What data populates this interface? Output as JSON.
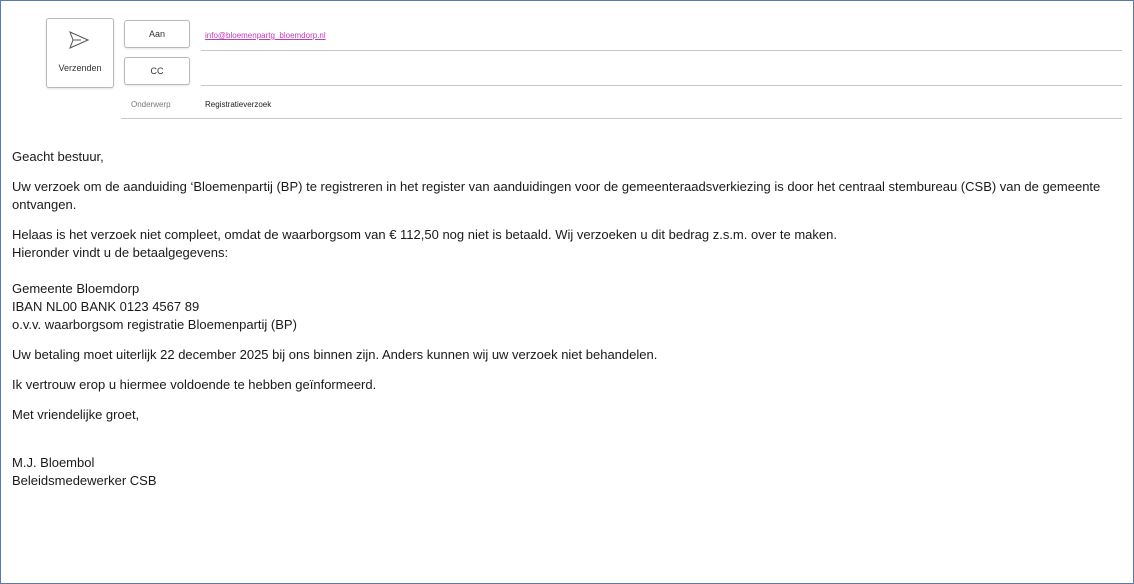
{
  "compose": {
    "send_label": "Verzenden",
    "to_label": "Aan",
    "to_value": "info@bloemenpartg_bloemdorp.nl",
    "cc_label": "CC",
    "cc_value": "",
    "subject_label": "Onderwerp",
    "subject_value": "Registratieverzoek"
  },
  "icons": {
    "send": "send-paper-plane-icon"
  },
  "colors": {
    "link": "#c03ab5",
    "frame_border": "#5a7aa8"
  },
  "body": {
    "greeting": "Geacht bestuur,",
    "p1": "Uw verzoek om de aanduiding ‘Bloemenpartij (BP) te registreren in het register van aanduidingen voor de gemeenteraadsverkiezing is door het centraal stembureau (CSB) van de gemeente ontvangen.",
    "p2_line1": "Helaas is het verzoek niet compleet, omdat de waarborgsom van € 112,50 nog niet is betaald. Wij verzoeken u dit bedrag z.s.m. over te maken.",
    "p2_line2": "Hieronder vindt u de betaalgegevens:",
    "pay_name": "Gemeente Bloemdorp",
    "pay_iban": "IBAN NL00 BANK 0123 4567 89",
    "pay_ref": "o.v.v. waarborgsom registratie Bloemenpartij (BP)",
    "deadline": "Uw betaling moet uiterlijk 22 december 2025 bij ons binnen zijn. Anders kunnen wij uw verzoek niet behandelen.",
    "trust": "Ik vertrouw erop u hiermee voldoende te hebben geïnformeerd.",
    "closing": "Met vriendelijke groet,",
    "sig_name": "M.J. Bloembol",
    "sig_title": "Beleidsmedewerker CSB"
  }
}
